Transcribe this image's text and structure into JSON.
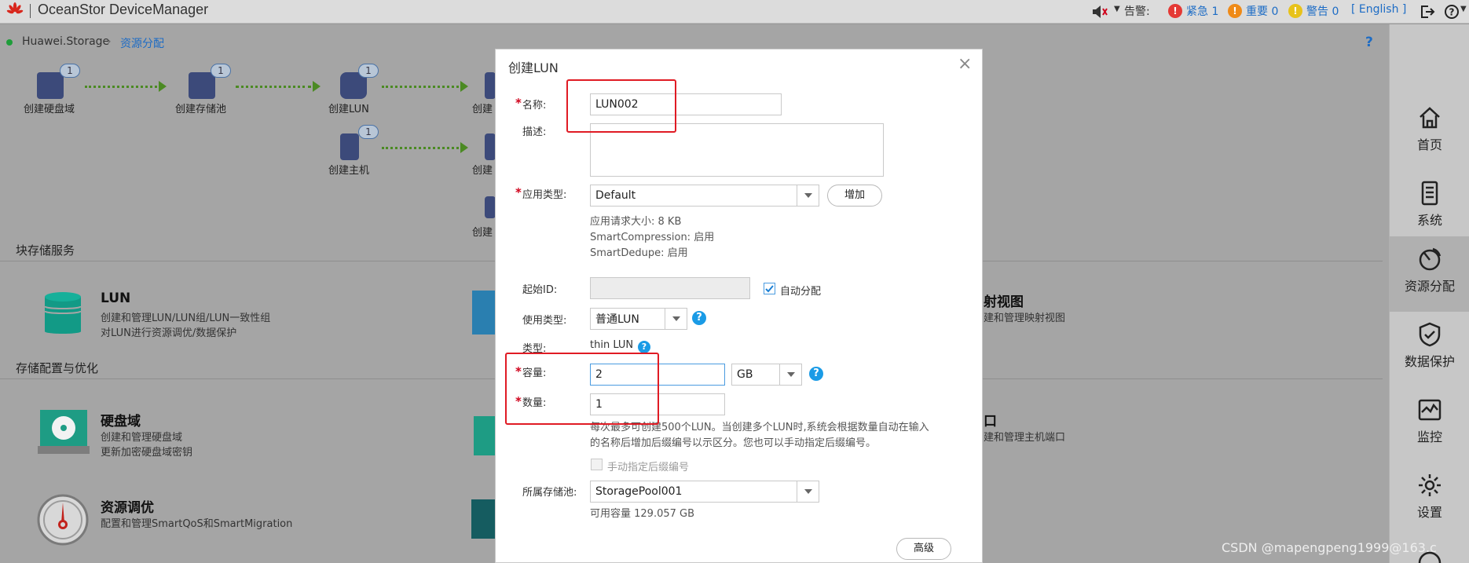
{
  "app": {
    "title": "OceanStor DeviceManager",
    "logo_text": "HUAWEI"
  },
  "topbar": {
    "sound_icon": "speaker-icon",
    "alarm_label": "告警:",
    "critical": "紧急 1",
    "major": "重要 0",
    "warning": "警告 0",
    "language": "[ English ]",
    "colors": {
      "critical": "#e53935",
      "major": "#ef8a17",
      "warning": "#e8c21a"
    }
  },
  "breadcrumb": {
    "root": "Huawei.Storage",
    "current": "资源分配",
    "help": "?"
  },
  "flow": {
    "items": [
      {
        "label": "创建硬盘域",
        "badge": "1"
      },
      {
        "label": "创建存储池",
        "badge": "1"
      },
      {
        "label": "创建LUN",
        "badge": "1"
      },
      {
        "label": "创建主机",
        "badge": "1"
      },
      {
        "label": "创建",
        "badge": ""
      },
      {
        "label": "创建",
        "badge": ""
      },
      {
        "label": "创建",
        "badge": ""
      }
    ]
  },
  "sections": {
    "block": "块存储服务",
    "config": "存储配置与优化"
  },
  "services": {
    "lun": {
      "title": "LUN",
      "desc1": "创建和管理LUN/LUN组/LUN一致性组",
      "desc2": "对LUN进行资源调优/数据保护"
    },
    "mapping": {
      "title": "射视图",
      "desc1": "建和管理映射视图"
    },
    "disk": {
      "title": "硬盘域",
      "desc1": "创建和管理硬盘域",
      "desc2": "更新加密硬盘域密钥"
    },
    "port": {
      "title": "口",
      "desc1": "建和管理主机端口"
    },
    "tuning": {
      "title": "资源调优",
      "desc1": "配置和管理SmartQoS和SmartMigration"
    }
  },
  "rightnav": {
    "items": [
      {
        "label": "首页",
        "icon": "home-icon"
      },
      {
        "label": "系统",
        "icon": "system-icon"
      },
      {
        "label": "资源分配",
        "icon": "provisioning-icon"
      },
      {
        "label": "数据保护",
        "icon": "shield-icon"
      },
      {
        "label": "监控",
        "icon": "monitor-icon"
      },
      {
        "label": "设置",
        "icon": "gear-icon"
      }
    ]
  },
  "dialog": {
    "title": "创建LUN",
    "name_label": "名称:",
    "name_value": "LUN002",
    "desc_label": "描述:",
    "desc_value": "",
    "app_type_label": "应用类型:",
    "app_type_value": "Default",
    "add_button": "增加",
    "app_info": [
      "应用请求大小:  8 KB",
      "SmartCompression:  启用",
      "SmartDedupe:  启用"
    ],
    "start_id_label": "起始ID:",
    "start_id_value": "",
    "auto_assign_label": "自动分配",
    "auto_assign_checked": true,
    "usage_type_label": "使用类型:",
    "usage_type_value": "普通LUN",
    "type_label": "类型:",
    "type_value": "thin LUN",
    "capacity_label": "容量:",
    "capacity_value": "2",
    "capacity_unit": "GB",
    "quantity_label": "数量:",
    "quantity_value": "1",
    "quantity_note1": "每次最多可创建500个LUN。当创建多个LUN时,系统会根据数量自动在输入",
    "quantity_note2": "的名称后增加后缀编号以示区分。您也可以手动指定后缀编号。",
    "manual_suffix_label": "手动指定后缀编号",
    "manual_suffix_checked": false,
    "pool_label": "所属存储池:",
    "pool_value": "StoragePool001",
    "available_capacity": "可用容量 129.057 GB",
    "advanced_button": "高级",
    "close_symbol": "×",
    "help_symbol": "?",
    "required_mark": "*"
  },
  "watermark": "CSDN @mapengpeng1999@163.c"
}
